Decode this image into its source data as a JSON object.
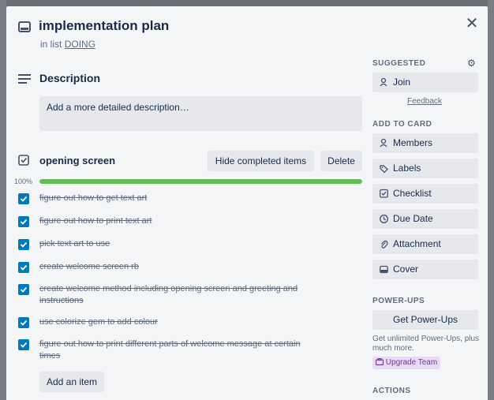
{
  "card": {
    "title": "implementation plan",
    "in_list_prefix": "in list ",
    "list_name": "DOING"
  },
  "description": {
    "heading": "Description",
    "placeholder": "Add a more detailed description…"
  },
  "checklist": {
    "title": "opening screen",
    "hide_completed_label": "Hide completed items",
    "delete_label": "Delete",
    "progress_text": "100%",
    "progress_fraction": 1.0,
    "items": [
      {
        "text": "figure out how to get text art",
        "checked": true
      },
      {
        "text": "figure out how to print text art",
        "checked": true
      },
      {
        "text": "pick text art to use",
        "checked": true
      },
      {
        "text": "create welcome screen rb",
        "checked": true
      },
      {
        "text": "create welcome method including opening screen and greeting and instructions",
        "checked": true
      },
      {
        "text": "use colorize gem to add colour",
        "checked": true
      },
      {
        "text": "figure out how to print different parts of welcome message at certain times",
        "checked": true
      }
    ],
    "add_item_label": "Add an item"
  },
  "sidebar": {
    "suggested_label": "SUGGESTED",
    "join_label": "Join",
    "feedback_label": "Feedback",
    "add_to_card_label": "ADD TO CARD",
    "add_to_card": [
      {
        "label": "Members",
        "icon": "person-icon"
      },
      {
        "label": "Labels",
        "icon": "tag-icon"
      },
      {
        "label": "Checklist",
        "icon": "checklist-icon"
      },
      {
        "label": "Due Date",
        "icon": "clock-icon"
      },
      {
        "label": "Attachment",
        "icon": "paperclip-icon"
      },
      {
        "label": "Cover",
        "icon": "cover-icon"
      }
    ],
    "power_ups_label": "POWER-UPS",
    "get_power_ups_label": "Get Power-Ups",
    "power_ups_note": "Get unlimited Power-Ups, plus much more.",
    "upgrade_label": "Upgrade Team",
    "actions_label": "ACTIONS"
  },
  "colors": {
    "progress": "#61bd4f",
    "checkbox": "#0079bf",
    "modal_bg": "#f4f5f7"
  }
}
